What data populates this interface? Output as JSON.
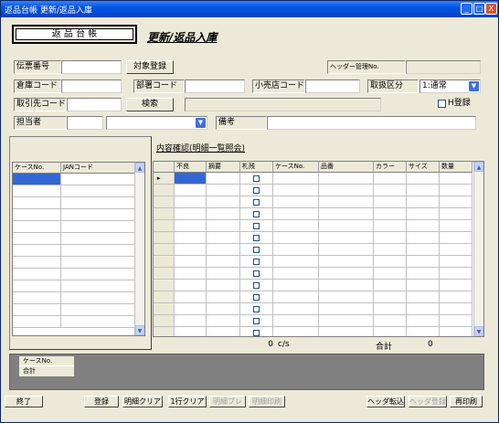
{
  "window": {
    "title": "返品台帳 更新/返品入庫",
    "minimize": "_",
    "maximize": "□",
    "close": "X"
  },
  "header": {
    "ledger_title": "返 品 台 帳",
    "subtitle": "更新/返品入庫"
  },
  "form": {
    "slip_no_label": "伝票番号",
    "slip_no_value": "",
    "target_register_button": "対象登録",
    "header_mgmt_label": "ヘッダー管理No.",
    "header_mgmt_value": "",
    "warehouse_label": "倉庫コード",
    "warehouse_value": "",
    "dept_label": "部署コード",
    "dept_value": "",
    "retail_label": "小売店コード",
    "retail_value": "",
    "category_label": "取扱区分",
    "category_value": "1:通常",
    "supplier_label": "取引先コード",
    "supplier_value": "",
    "search_button": "検索",
    "supplier_name_value": "",
    "h_register_label": "H登録",
    "person_label": "担当者",
    "person_code_value": "",
    "person_select_value": "",
    "remarks_label": "備考",
    "remarks_value": ""
  },
  "left_grid": {
    "columns": [
      "ケースNo.",
      "JANコード"
    ],
    "scroll_up": "▲",
    "scroll_down": "▼"
  },
  "main_grid": {
    "title": "内容確認(明細一覧照会)",
    "columns": [
      "不良",
      "摘要",
      "札残",
      "ケースNo.",
      "品番",
      "カラー",
      "サイズ",
      "数量"
    ],
    "row_indicator": "▸",
    "scroll_up": "▲",
    "scroll_down": "▼"
  },
  "totals": {
    "cases_value": "0",
    "cases_unit": "c/s",
    "total_label": "合計",
    "total_value": "0"
  },
  "summary": {
    "case_label": "ケースNo.",
    "total_label": "合計"
  },
  "footer": {
    "end_button": "終了",
    "register_button": "登録",
    "detail_clear_button": "明細クリア",
    "line_clear_button": "1行クリア",
    "detail_preview_button": "明細プレ",
    "detail_print_button": "明細印刷",
    "header_capture_button": "ヘッダ転込",
    "header_register_button": "ヘッダ登録",
    "reprint_button": "再印刷"
  },
  "colors": {
    "titlebar": "#0054e3",
    "window_bg": "#ece9d8",
    "summary_bg": "#808080",
    "selected_cell": "#3168d5"
  }
}
